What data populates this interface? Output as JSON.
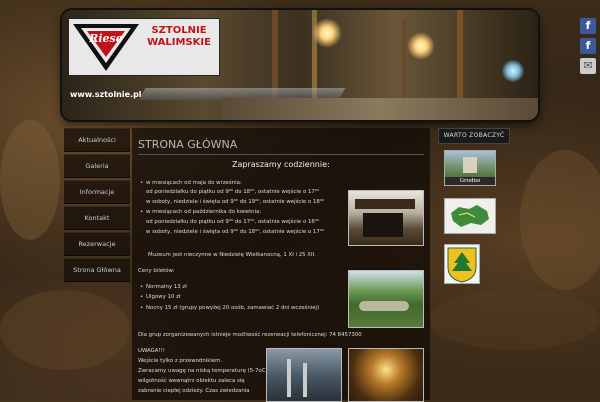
{
  "logo": {
    "brand": "Riese",
    "line1": "SZTOLNIE",
    "line2": "WALIMSKIE",
    "url": "www.sztolnie.pl"
  },
  "social": [
    {
      "name": "facebook",
      "glyph": "f",
      "color": "#3b5998"
    },
    {
      "name": "facebook",
      "glyph": "f",
      "color": "#3b5998"
    },
    {
      "name": "email",
      "glyph": "✉",
      "color": "#cccccc"
    }
  ],
  "nav": [
    "Aktualności",
    "Galeria",
    "Informacje",
    "Kontakt",
    "Rezerwacje",
    "Strona Główna"
  ],
  "main": {
    "title": "STRONA GŁÓWNA",
    "invite": "Zapraszamy codziennie:",
    "schedule": [
      {
        "bullet": true,
        "text": "w miesiącach od maja do września:"
      },
      {
        "bullet": false,
        "text": "od poniedziałku do piątku od 9⁰⁰ do 18⁰⁰, ostatnie wejście o 17⁰⁰"
      },
      {
        "bullet": false,
        "text": "w soboty, niedziele i święta od 9⁰⁰ do 19⁰⁰, ostatnie wejście o 18⁰⁰"
      },
      {
        "bullet": true,
        "text": "w miesiącach od października do kwietnia:"
      },
      {
        "bullet": false,
        "text": "od poniedziałku do piątku od 9⁰⁰ do 17⁰⁰, ostatnie wejście o 16⁰⁰"
      },
      {
        "bullet": false,
        "text": "w soboty, niedziele i święta od 9⁰⁰ do 18⁰⁰, ostatnie wejście o 17⁰⁰"
      }
    ],
    "closed": "Muzeum jest nieczynne w Niedzielę Wielkanocną, 1 XI i 25 XII.",
    "prices_label": "Ceny biletów:",
    "prices": [
      "Normalny 13 zł",
      "Ulgowy 10 zł",
      "Nocny 15 zł (grupy powyżej 20 osób, zamawiać 2 dni wcześniej)"
    ],
    "groups": "Dla grup zorganizowanych istnieje możliwość rezerwacji telefonicznej: 74 8457300",
    "warning_title": "UWAGA!!!",
    "warning_lines": [
      "Wejście tylko z przewodnikiem.",
      "Zwracamy uwagę na niską temperaturę (5-7oC) i dużą",
      "wilgotność wewnątrz obiektu zaleca się",
      "zabranie ciepłej odzieży. Czas zwiedzania"
    ]
  },
  "right": {
    "title": "WARTO ZOBACZYĆ",
    "thumb1_caption": "Grodno"
  }
}
